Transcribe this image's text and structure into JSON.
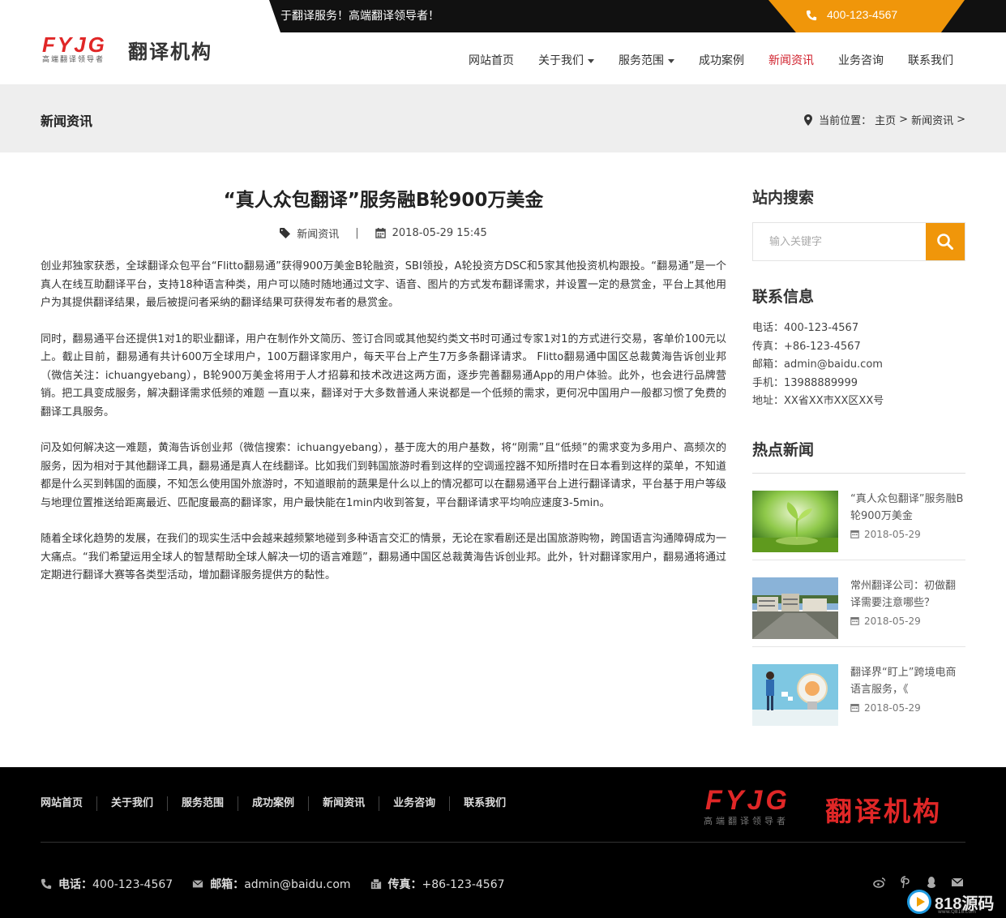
{
  "topbar": {
    "slogan": "于翻译服务！高端翻译领导者！",
    "phone": "400-123-4567"
  },
  "logo": {
    "brand": "FYJG",
    "tagline": "高端翻译领导者",
    "name": "翻译机构"
  },
  "nav": {
    "items": [
      {
        "label": "网站首页"
      },
      {
        "label": "关于我们"
      },
      {
        "label": "服务范围"
      },
      {
        "label": "成功案例"
      },
      {
        "label": "新闻资讯"
      },
      {
        "label": "业务咨询"
      },
      {
        "label": "联系我们"
      }
    ],
    "active_index": 4
  },
  "banner": {
    "title": "新闻资讯",
    "breadcrumb_prefix": "当前位置：",
    "crumb_home": "主页",
    "crumb_sep1": ">",
    "crumb_current": "新闻资讯",
    "crumb_sep2": ">"
  },
  "article": {
    "title": "“真人众包翻译”服务融B轮900万美金",
    "category": "新闻资讯",
    "separator": "|",
    "datetime": "2018-05-29 15:45",
    "paragraphs": [
      "创业邦独家获悉，全球翻译众包平台“Flitto翻易通”获得900万美金B轮融资，SBI领投，A轮投资方DSC和5家其他投资机构跟投。“翻易通”是一个真人在线互助翻译平台，支持18种语言种类，用户可以随时随地通过文字、语音、图片的方式发布翻译需求，并设置一定的悬赏金，平台上其他用户为其提供翻译结果，最后被提问者采纳的翻译结果可获得发布者的悬赏金。",
      "同时，翻易通平台还提供1对1的职业翻译，用户在制作外文简历、签订合同或其他契约类文书时可通过专家1对1的方式进行交易，客单价100元以上。截止目前，翻易通有共计600万全球用户，100万翻译家用户，每天平台上产生7万多条翻译请求。 Flitto翻易通中国区总裁黄海告诉创业邦（微信关注：ichuangyebang），B轮900万美金将用于人才招募和技术改进这两方面，逐步完善翻易通App的用户体验。此外，也会进行品牌营销。把工具变成服务，解决翻译需求低频的难题 一直以来，翻译对于大多数普通人来说都是一个低频的需求，更何况中国用户一般都习惯了免费的翻译工具服务。",
      "问及如何解决这一难题，黄海告诉创业邦（微信搜索：ichuangyebang），基于庞大的用户基数，将“刚需”且“低频”的需求变为多用户、高频次的服务，因为相对于其他翻译工具，翻易通是真人在线翻译。比如我们到韩国旅游时看到这样的空调遥控器不知所措时在日本看到这样的菜单，不知道都是什么买到韩国的面膜，不知怎么使用国外旅游时，不知道眼前的蔬果是什么以上的情况都可以在翻易通平台上进行翻译请求，平台基于用户等级与地理位置推送给距离最近、匹配度最高的翻译家，用户最快能在1min内收到答复，平台翻译请求平均响应速度3-5min。",
      "随着全球化趋势的发展，在我们的现实生活中会越来越频繁地碰到多种语言交汇的情景，无论在家看剧还是出国旅游购物，跨国语言沟通障碍成为一大痛点。“我们希望运用全球人的智慧帮助全球人解决一切的语言难题”，翻易通中国区总裁黄海告诉创业邦。此外，针对翻译家用户，翻易通将通过定期进行翻译大赛等各类型活动，增加翻译服务提供方的黏性。"
    ]
  },
  "sidebar": {
    "search_heading": "站内搜索",
    "search_placeholder": "输入关键字",
    "contact_heading": "联系信息",
    "contact": [
      "电话：400-123-4567",
      "传真：+86-123-4567",
      "邮箱：admin@baidu.com",
      "手机：13988889999",
      "地址：XX省XX市XX区XX号"
    ],
    "hot_heading": "热点新闻",
    "hot_news": [
      {
        "title": "“真人众包翻译”服务融B轮900万美金",
        "date": "2018-05-29"
      },
      {
        "title": "常州翻译公司：初做翻译需要注意哪些？",
        "date": "2018-05-29"
      },
      {
        "title": "翻译界“盯上”跨境电商语言服务，《",
        "date": "2018-05-29"
      }
    ]
  },
  "footer": {
    "nav": [
      "网站首页",
      "关于我们",
      "服务范围",
      "成功案例",
      "新闻资讯",
      "业务咨询",
      "联系我们"
    ],
    "logo_brand": "FYJG",
    "logo_tagline": "高端翻译领导者",
    "logo_name": "翻译机构",
    "phone_label": "电话：",
    "phone": "400-123-4567",
    "email_label": "邮箱：",
    "email": "admin@baidu.com",
    "fax_label": "传真：",
    "fax": "+86-123-4567",
    "social_icons": [
      "weibo-icon",
      "pinterest-icon",
      "qq-icon",
      "mail-icon"
    ],
    "watermark": "818源码",
    "watermark_sub": "www.Q818.com"
  },
  "colors": {
    "accent_orange": "#f0960a",
    "brand_red": "#e02727",
    "active_nav": "#d01f2b"
  }
}
